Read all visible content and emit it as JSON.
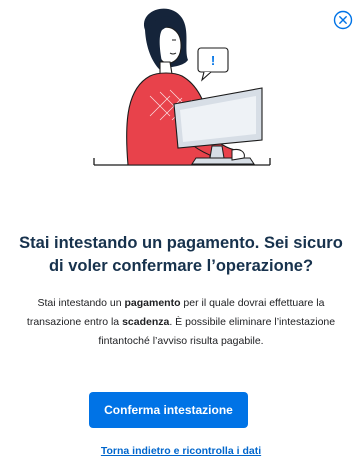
{
  "dialog": {
    "title": "Stai intestando un pagamento. Sei sicuro di voler confermare l’operazione?",
    "body": {
      "part1": "Stai intestando un ",
      "bold1": "pagamento",
      "part2": " per il quale dovrai effettuare la transazione entro la ",
      "bold2": "scadenza",
      "part3": ". È possibile eliminare l’intestazione fintantoché l’avviso risulta pagabile."
    },
    "confirm_label": "Conferma intestazione",
    "back_label": "Torna indietro e ricontrolla i dati",
    "speech_bubble_text": "!"
  },
  "icons": {
    "close": "close-circle-icon",
    "illustration": "person-at-computer-illustration"
  },
  "colors": {
    "primary": "#0073e6",
    "link": "#0066cc",
    "title": "#17324d",
    "sweater": "#e8424b",
    "bubble_accent": "#0073e6"
  }
}
